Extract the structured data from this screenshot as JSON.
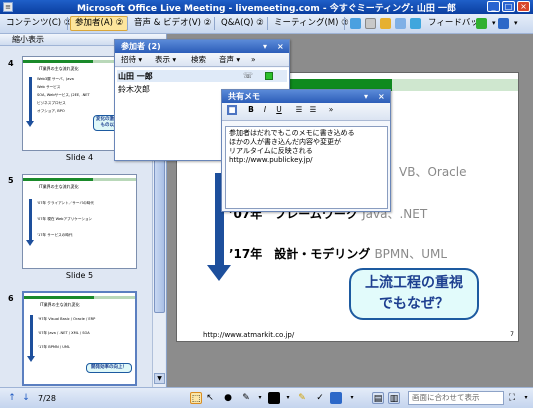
{
  "window": {
    "title": "Microsoft Office Live Meeting - livemeeting.com - 今すぐミーティング: 山田 一郎",
    "app_icon": "live-meeting-icon",
    "controls": [
      "_",
      "□",
      "×"
    ]
  },
  "menubar": {
    "items": [
      {
        "label": "コンテンツ(C) ②"
      },
      {
        "label": "参加者(A) ②"
      },
      {
        "label": "音声 & ビデオ(V) ②"
      },
      {
        "label": "Q&A(Q) ②"
      },
      {
        "label": "ミーティング(M) ②"
      }
    ],
    "feedback_label": "フィードバック"
  },
  "thumbnail_pane": {
    "header": "縮小表示",
    "slides": [
      {
        "number": "4",
        "caption": "Slide 4",
        "title": "IT業界の主な流れ変化",
        "lines": [
          "Web3層 サーバ、Java",
          "Web サービス",
          "SOA, Webサービス, J2EE, .NET",
          "ビジネスプロセス",
          "オフショア, BPO"
        ],
        "bubble": "変化の激しい業界もの以外は？"
      },
      {
        "number": "5",
        "caption": "Slide 5",
        "title": "IT業界の主な流れ変化",
        "lines": [
          "'07年 クライアント／サーバの時代",
          "'07年 現在 Webアプリケーション",
          "'17年 サービスの時代"
        ]
      },
      {
        "number": "6",
        "caption": "",
        "title": "IT業界の主な流れ変化",
        "lines": [
          "'97年 Visual Basic / Oracle / ERP",
          "'07年 Java / .NET / XML / SOA",
          "'17年 BPMN / UML"
        ],
        "bubble": "開発効率の向上！"
      }
    ]
  },
  "main_slide": {
    "lines": [
      {
        "text": "VB、Oracle",
        "highlight": ""
      },
      {
        "text": "’07年　フレームワーク",
        "highlight": "Java、.NET"
      },
      {
        "text": "’17年　設計・モデリング",
        "highlight": "BPMN、UML"
      }
    ],
    "bubble": "上流工程の重視\nでもなぜ？",
    "url": "http://www.atmarkit.co.jp/",
    "page_number": "7"
  },
  "participants_window": {
    "title": "参加者 (2)",
    "toolbar": [
      "招待 ▾",
      "表示 ▾",
      "検索",
      "音声 ▾",
      "»"
    ],
    "participants": [
      "山田 一郎",
      "鈴木次郎"
    ]
  },
  "notes_window": {
    "title": "共有メモ",
    "format_buttons": [
      "B",
      "I",
      "U"
    ],
    "content": [
      "参加者はだれでもこのメモに書き込める",
      "ほかの人が書き込んだ内容や変更が",
      "リアルタイムに反映される",
      "http://www.publickey.jp/"
    ]
  },
  "bottombar": {
    "page_indicator": "7/28",
    "zoom_label": "画面に合わせて表示"
  },
  "colors": {
    "titlebar": "#0a3ea0",
    "slide_green": "#0f8a1e",
    "arrow_blue": "#1d4f9c",
    "status_green": "#2cc02c"
  }
}
